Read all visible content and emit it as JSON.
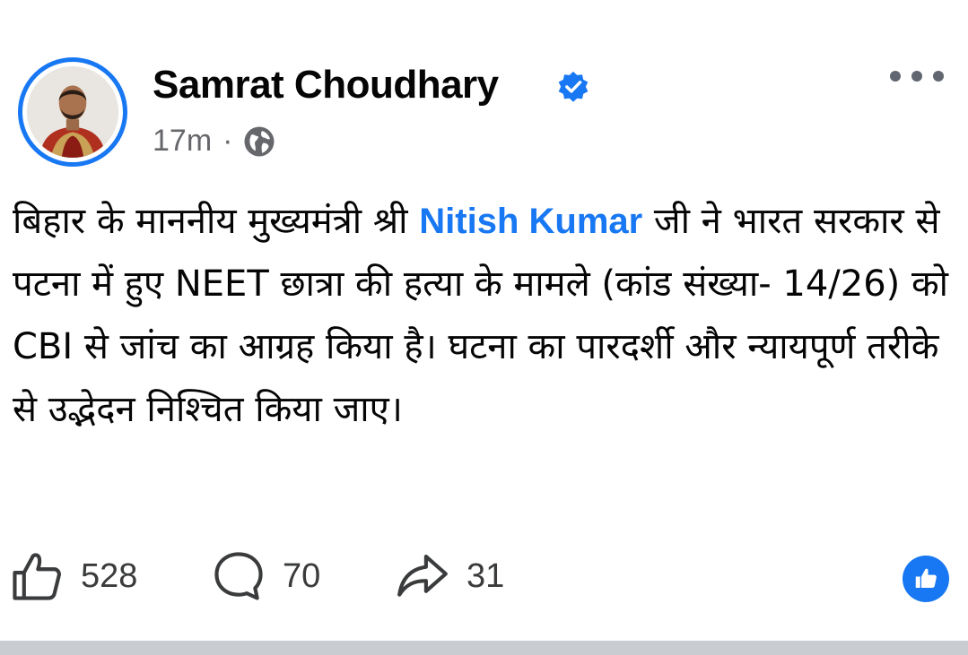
{
  "post": {
    "author": "Samrat Choudhary",
    "time": "17m",
    "separator": "·",
    "text_before": "बिहार के माननीय मुख्यमंत्री श्री ",
    "mention": "Nitish Kumar",
    "text_after": " जी ने भारत सरकार से पटना में हुए NEET छात्रा की हत्या के मामले (कांड संख्या- 14/26) को CBI से जांच का आग्रह किया है। घटना का पारदर्शी और न्यायपूर्ण तरीके से उद्भेदन निश्चित किया जाए।"
  },
  "actions": {
    "likes": "528",
    "comments": "70",
    "shares": "31"
  },
  "icons": {
    "verified": "verified-badge-icon",
    "privacy": "globe-icon",
    "more": "more-options-icon",
    "like": "thumbs-up-icon",
    "comment": "comment-icon",
    "share": "share-icon",
    "reaction": "like-reaction-icon"
  },
  "colors": {
    "accent": "#1877f2",
    "text": "#050505",
    "muted": "#65676b"
  }
}
